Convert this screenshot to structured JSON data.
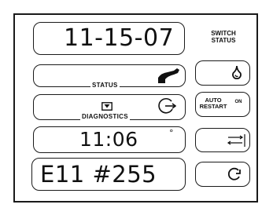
{
  "panel": {
    "date": "11-15-07",
    "status_label": "STATUS",
    "diagnostics_label": "DIAGNOSTICS",
    "time": "11:06",
    "degree_mark": "°",
    "code": "E11 #255"
  },
  "switch_status": {
    "header_line1": "SWITCH",
    "header_line2": "STATUS",
    "auto_restart_line1": "AUTO",
    "auto_restart_line2": "RESTART",
    "auto_restart_state": "ON"
  },
  "icons": {
    "status": "hose-nozzle-icon",
    "diagnostics_box": "diagnostics-box-icon",
    "diagnostics_rotate": "rotate-arrow-icon",
    "switch_1": "water-drop-icon",
    "switch_3": "transfer-arrows-icon",
    "switch_4": "circular-arrow-icon"
  }
}
